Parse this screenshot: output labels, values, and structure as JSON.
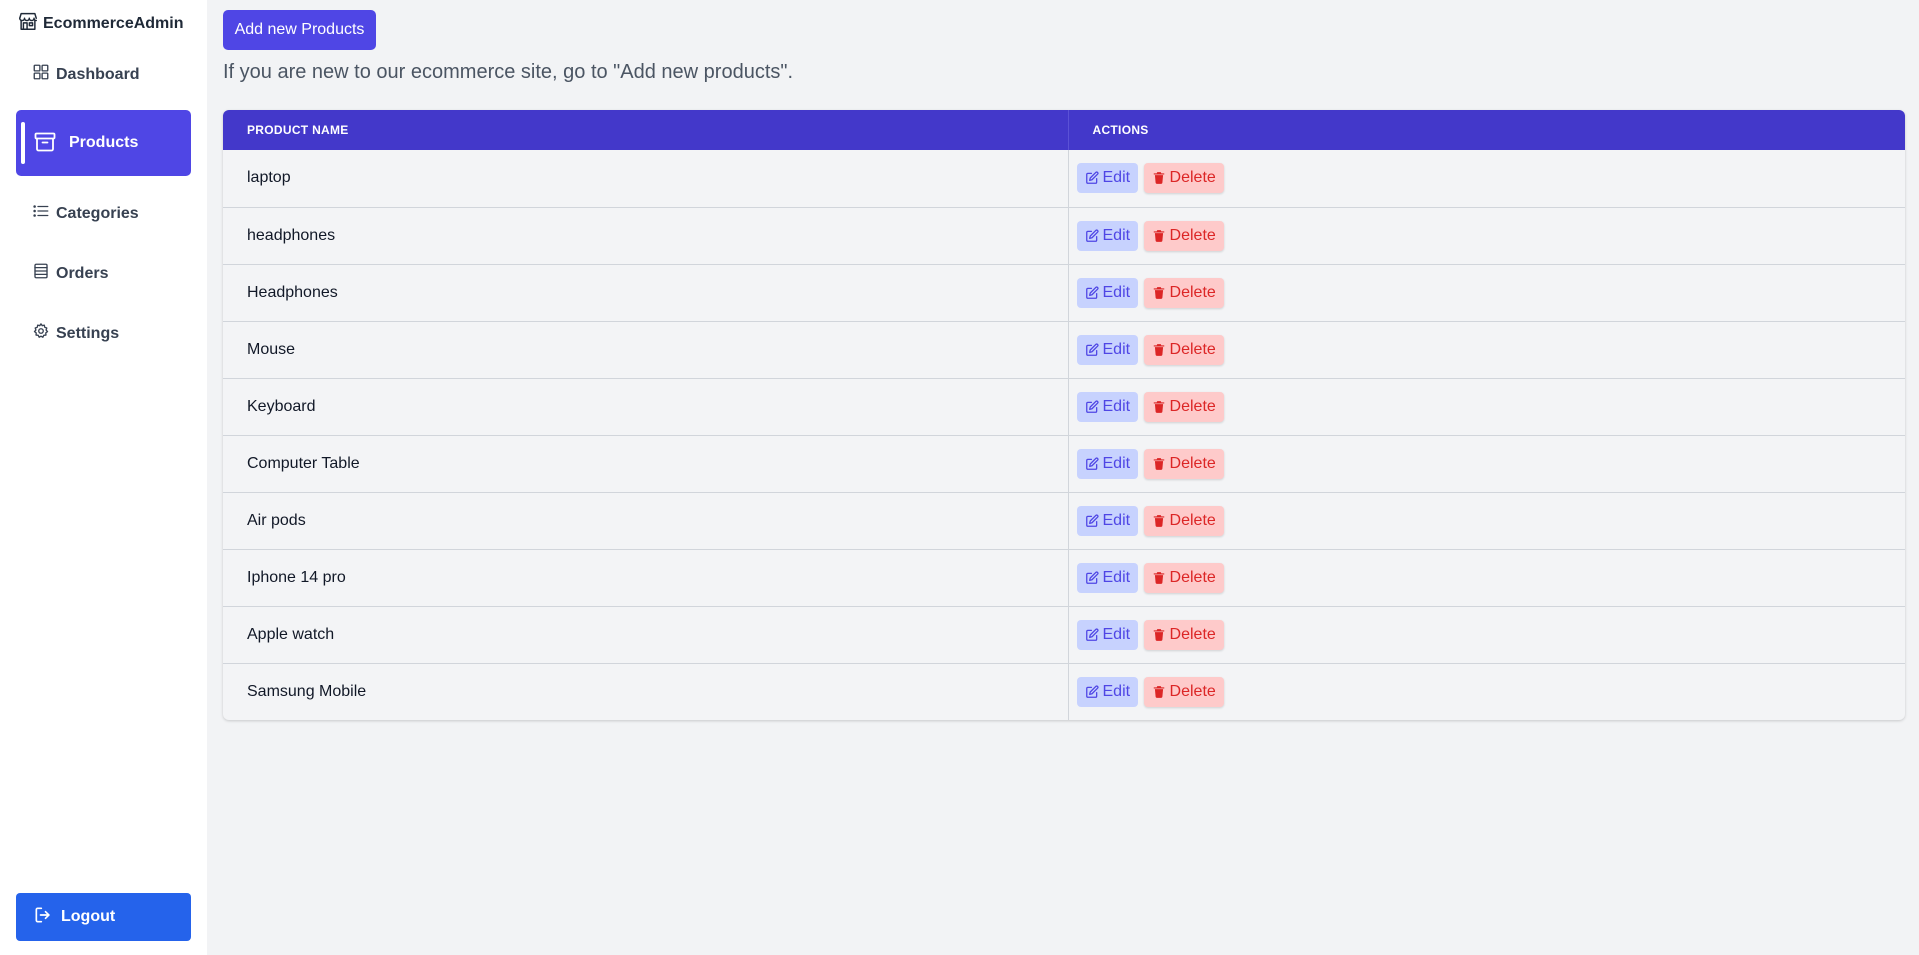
{
  "app": {
    "title": "EcommerceAdmin"
  },
  "sidebar": {
    "items": [
      {
        "label": "Dashboard",
        "icon": "grid-icon"
      },
      {
        "label": "Products",
        "icon": "archive-box-icon",
        "active": true
      },
      {
        "label": "Categories",
        "icon": "list-icon"
      },
      {
        "label": "Orders",
        "icon": "stack-icon"
      },
      {
        "label": "Settings",
        "icon": "gear-icon"
      }
    ],
    "logout_label": "Logout"
  },
  "main": {
    "add_button_label": "Add new Products",
    "intro_text": "If you are new to our ecommerce site, go to \"Add new products\".",
    "table": {
      "columns": [
        "PRODUCT NAME",
        "ACTIONS"
      ],
      "edit_label": "Edit",
      "delete_label": "Delete",
      "rows": [
        "laptop",
        "headphones",
        "Headphones",
        "Mouse",
        "Keyboard",
        "Computer Table",
        "Air pods",
        "Iphone 14 pro",
        "Apple watch",
        "Samsung Mobile"
      ]
    }
  },
  "colors": {
    "accent": "#4f46e5",
    "header": "#4338ca",
    "logout": "#2563eb",
    "edit_bg": "#c7d2fe",
    "delete_bg": "#fecaca",
    "delete_text": "#dc2626"
  }
}
